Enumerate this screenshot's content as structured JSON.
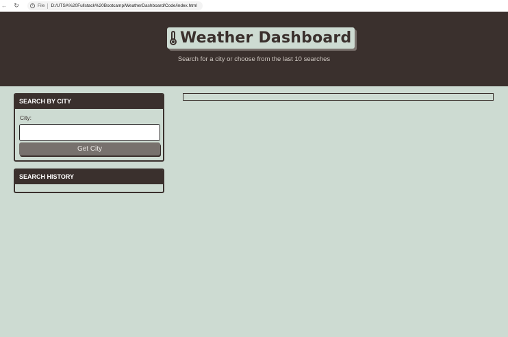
{
  "browser": {
    "back_icon": "back-arrow-icon",
    "reload_icon": "reload-icon",
    "info_icon": "info-icon",
    "scheme_label": "File",
    "url": "D:/UTSA%20Fullstack%20Bootcamp/WeatherDashboard/Code/index.html"
  },
  "header": {
    "title": "Weather Dashboard",
    "title_icon": "thermometer-icon",
    "subtitle": "Search for a city or choose from the last 10 searches"
  },
  "search_card": {
    "heading": "SEARCH BY CITY",
    "city_label": "City:",
    "city_value": "",
    "button_label": "Get City"
  },
  "history_card": {
    "heading": "SEARCH HISTORY",
    "items": []
  },
  "colors": {
    "header_bg": "#3a302d",
    "page_bg": "#cddbd2",
    "button_bg": "#77716d"
  }
}
